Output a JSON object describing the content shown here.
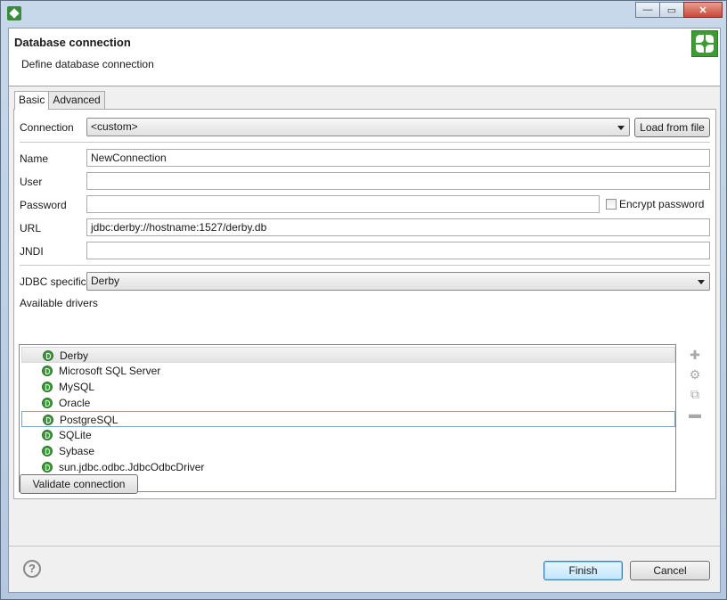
{
  "window": {
    "title": "",
    "buttons": [
      "—",
      "▭",
      "✕"
    ]
  },
  "header": {
    "title": "Database connection",
    "subtitle": "Define database connection"
  },
  "tabs": [
    {
      "label": "Basic",
      "active": true
    },
    {
      "label": "Advanced",
      "active": false
    }
  ],
  "form": {
    "connection_label": "Connection",
    "connection_value": "<custom>",
    "load_button": "Load from file",
    "name_label": "Name",
    "name_value": "NewConnection",
    "user_label": "User",
    "user_value": "",
    "password_label": "Password",
    "password_value": "",
    "encrypt_label": "Encrypt password",
    "encrypt_checked": false,
    "url_label": "URL",
    "url_value": "jdbc:derby://hostname:1527/derby.db",
    "jndi_label": "JNDI",
    "jndi_value": "",
    "jdbc_label": "JDBC specific",
    "jdbc_value": "Derby",
    "drivers_label": "Available drivers"
  },
  "drivers": [
    "Derby",
    "Microsoft SQL Server",
    "MySQL",
    "Oracle",
    "PostgreSQL",
    "SQLite",
    "Sybase",
    "sun.jdbc.odbc.JdbcOdbcDriver"
  ],
  "driver_actions": [
    "add-icon",
    "edit-icon",
    "copy-icon",
    "remove-icon"
  ],
  "validate_button": "Validate connection",
  "footer": {
    "help": "?",
    "finish": "Finish",
    "cancel": "Cancel"
  },
  "colors": {
    "accent": "#3f9b35",
    "selection_border": "#7da2ce"
  }
}
